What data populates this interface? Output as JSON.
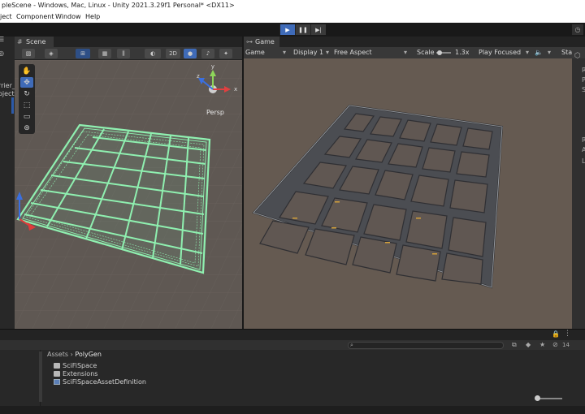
{
  "window": {
    "title": "pleScene - Windows, Mac, Linux - Unity 2021.3.29f1 Personal* <DX11>"
  },
  "menu": {
    "items": [
      "ject",
      "Component",
      "Window",
      "Help"
    ]
  },
  "left_panel": {
    "lines": [
      "rrier_",
      "oject"
    ]
  },
  "scene": {
    "tab_label": "Scene",
    "mode_2d": "2D",
    "persp_label": "Persp"
  },
  "game": {
    "tab_label": "Game",
    "view_mode": "Game",
    "display": "Display 1",
    "aspect": "Free Aspect",
    "scale_label": "Scale",
    "scale_value": "1.3x",
    "play_mode": "Play Focused",
    "stats_label": "Sta"
  },
  "inspector": {
    "letters": [
      "R",
      "P",
      "S",
      "R",
      "A",
      "L"
    ]
  },
  "project": {
    "breadcrumb_root": "Assets",
    "breadcrumb_sep": "›",
    "breadcrumb_current": "PolyGen",
    "items": [
      {
        "name": "SciFiSpace",
        "kind": "folder"
      },
      {
        "name": "Extensions",
        "kind": "folder"
      },
      {
        "name": "SciFiSpaceAssetDefinition",
        "kind": "asset"
      }
    ],
    "count_badge": "14"
  },
  "colors": {
    "accent": "#3f6bb8",
    "scene_bg": "#5f5853",
    "game_bg": "#655a51",
    "wire": "#8ff0b0"
  }
}
